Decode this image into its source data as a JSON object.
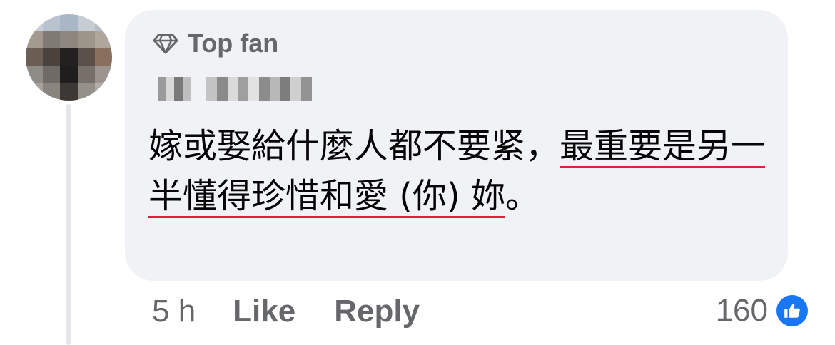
{
  "comment": {
    "badge": "Top fan",
    "text_before": "嫁或娶給什麼人都不要紧，",
    "text_highlight": "最重要是另一半懂得珍惜和愛 (你) 妳",
    "text_after": "。",
    "timestamp": "5 h",
    "like_label": "Like",
    "reply_label": "Reply",
    "reaction_count": "160"
  },
  "colors": {
    "bubble": "#f0f2f5",
    "secondary_text": "#65676b",
    "primary_text": "#050505",
    "like_blue": "#1877f2",
    "underline_red": "#e41e3f"
  },
  "icons": {
    "badge": "diamond-icon",
    "reaction": "thumbs-up-icon"
  }
}
